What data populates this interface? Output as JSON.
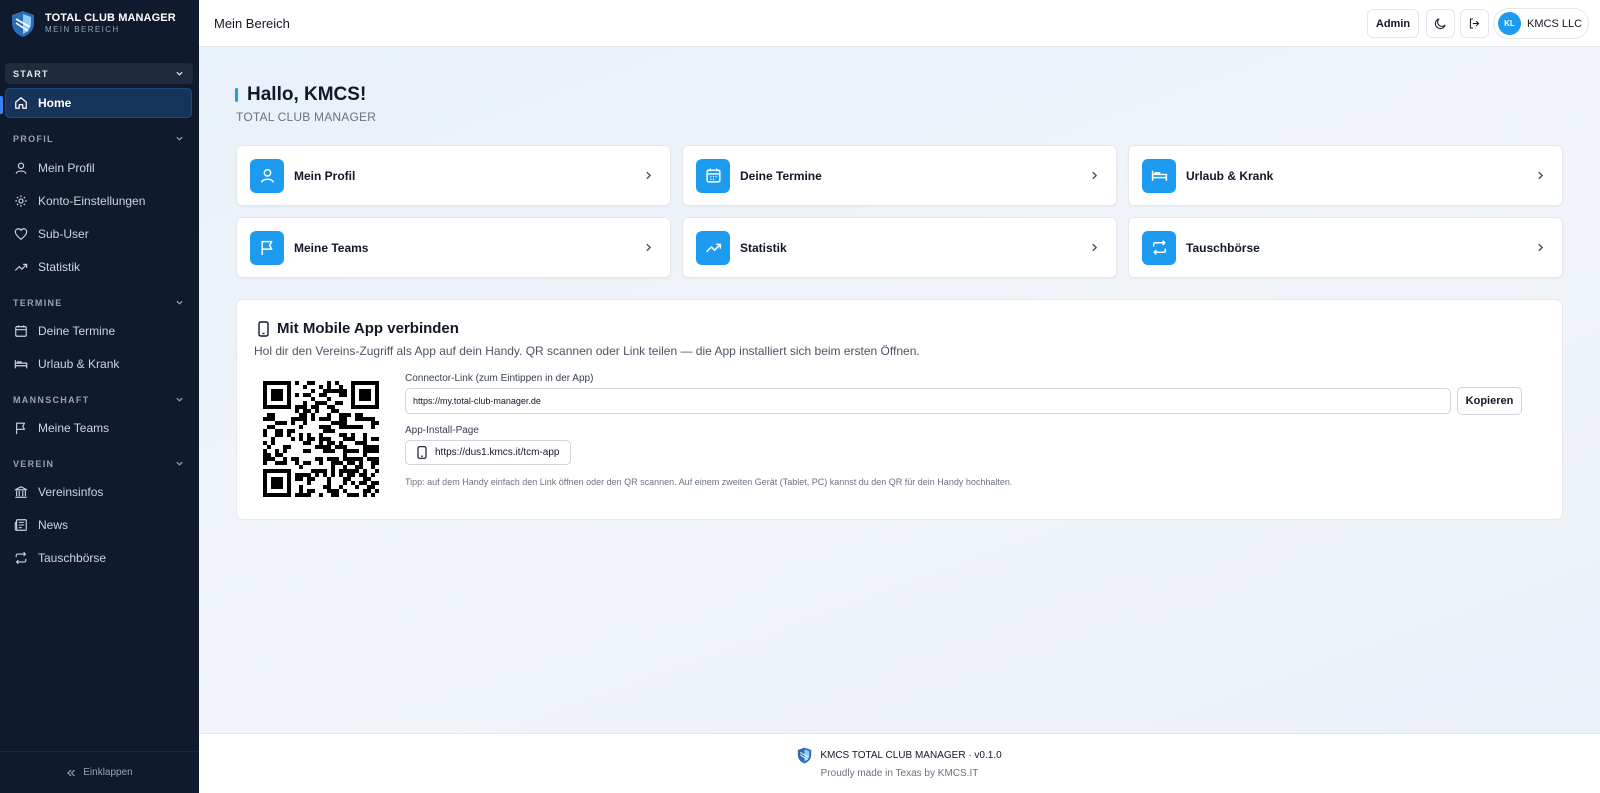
{
  "brand": {
    "title": "TOTAL CLUB MANAGER",
    "subtitle": "MEIN BEREICH"
  },
  "sidebar": {
    "sections": [
      {
        "label": "START"
      },
      {
        "label": "PROFIL"
      },
      {
        "label": "TERMINE"
      },
      {
        "label": "MANNSCHAFT"
      },
      {
        "label": "VEREIN"
      }
    ],
    "items": [
      {
        "label": "Home",
        "icon": "home-icon",
        "active": true
      },
      {
        "label": "Mein Profil",
        "icon": "user-icon"
      },
      {
        "label": "Konto-Einstellungen",
        "icon": "gear-icon"
      },
      {
        "label": "Sub-User",
        "icon": "heart-icon"
      },
      {
        "label": "Statistik",
        "icon": "trend-up-icon"
      },
      {
        "label": "Deine Termine",
        "icon": "calendar-icon"
      },
      {
        "label": "Urlaub & Krank",
        "icon": "bed-icon"
      },
      {
        "label": "Meine Teams",
        "icon": "flag-icon"
      },
      {
        "label": "Vereinsinfos",
        "icon": "building-icon"
      },
      {
        "label": "News",
        "icon": "newspaper-icon"
      },
      {
        "label": "Tauschbörse",
        "icon": "repeat-icon"
      }
    ],
    "collapse_label": "Einklappen"
  },
  "topbar": {
    "title": "Mein Bereich",
    "admin_label": "Admin",
    "user_initials": "KL",
    "user_name": "KMCS LLC"
  },
  "main": {
    "greeting": "Hallo, KMCS!",
    "subtitle": "TOTAL CLUB MANAGER",
    "cards": [
      {
        "label": "Mein Profil",
        "icon": "user-icon"
      },
      {
        "label": "Deine Termine",
        "icon": "calendar-icon"
      },
      {
        "label": "Urlaub & Krank",
        "icon": "bed-icon"
      },
      {
        "label": "Meine Teams",
        "icon": "flag-icon"
      },
      {
        "label": "Statistik",
        "icon": "trend-up-icon"
      },
      {
        "label": "Tauschbörse",
        "icon": "repeat-icon"
      }
    ],
    "mobile": {
      "title": "Mit Mobile App verbinden",
      "description": "Hol dir den Vereins-Zugriff als App auf dein Handy. QR scannen oder Link teilen — die App installiert sich beim ersten Öffnen.",
      "connector_label": "Connector-Link (zum Eintippen in der App)",
      "connector_value": "https://my.total-club-manager.de",
      "copy_label": "Kopieren",
      "install_label": "App-Install-Page",
      "install_link": "https://dus1.kmcs.it/tcm-app",
      "tip": "Tipp: auf dem Handy einfach den Link öffnen oder den QR scannen. Auf einem zweiten Gerät (Tablet, PC) kannst du den QR für dein Handy hochhalten."
    }
  },
  "footer": {
    "line1": "KMCS TOTAL CLUB MANAGER · v0.1.0",
    "line2": "Proudly made in Texas by KMCS.IT"
  },
  "colors": {
    "sidebar_bg": "#0f1a2c",
    "accent": "#1d9bf0",
    "active_item_bg": "#16345a"
  }
}
